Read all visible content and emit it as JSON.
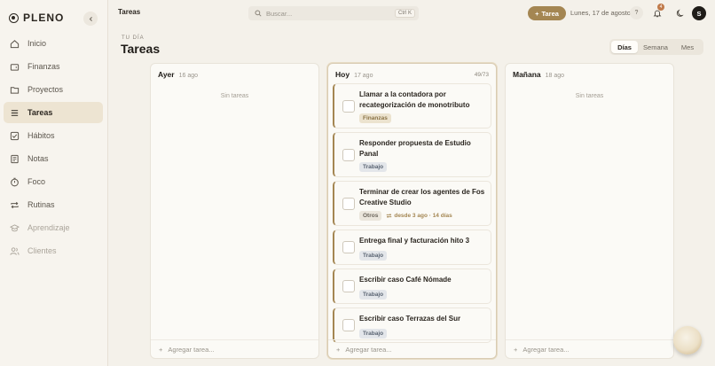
{
  "app": {
    "name": "PLENO"
  },
  "sidebar": {
    "items": [
      {
        "label": "Inicio",
        "icon": "home-icon"
      },
      {
        "label": "Finanzas",
        "icon": "wallet-icon"
      },
      {
        "label": "Proyectos",
        "icon": "folder-icon"
      },
      {
        "label": "Tareas",
        "icon": "list-icon",
        "active": true
      },
      {
        "label": "Hábitos",
        "icon": "check-square-icon"
      },
      {
        "label": "Notas",
        "icon": "note-icon"
      },
      {
        "label": "Foco",
        "icon": "timer-icon"
      },
      {
        "label": "Rutinas",
        "icon": "repeat-icon"
      },
      {
        "label": "Aprendizaje",
        "icon": "graduation-icon",
        "dim": true
      },
      {
        "label": "Clientes",
        "icon": "users-icon",
        "dim": true
      }
    ]
  },
  "topbar": {
    "title": "Tareas",
    "search_placeholder": "Buscar...",
    "search_shortcut": "Ctrl K",
    "new_task_label": "Tarea",
    "date": "Lunes, 17 de agosto",
    "help_label": "?",
    "notifications_count": "4",
    "avatar_initial": "S"
  },
  "header": {
    "eyebrow": "TU DÍA",
    "title": "Tareas",
    "views": [
      "Días",
      "Semana",
      "Mes"
    ],
    "active_view": "Días"
  },
  "columns": {
    "yesterday": {
      "day": "Ayer",
      "date": "16 ago",
      "empty": "Sin tareas",
      "add": "Agregar tarea..."
    },
    "today": {
      "day": "Hoy",
      "date": "17 ago",
      "count": "49/73",
      "add": "Agregar tarea..."
    },
    "tomorrow": {
      "day": "Mañana",
      "date": "18 ago",
      "empty": "Sin tareas",
      "add": "Agregar tarea..."
    }
  },
  "tasks": [
    {
      "title": "Llamar a la contadora por recategorización de monotributo",
      "tag": "Finanzas"
    },
    {
      "title": "Responder propuesta de Estudio Panal",
      "tag": "Trabajo"
    },
    {
      "title": "Terminar de crear los agentes de Fos Creative Studio",
      "tag": "Otros",
      "streak": "desde 3 ago · 14 días"
    },
    {
      "title": "Entrega final y facturación hito 3",
      "tag": "Trabajo"
    },
    {
      "title": "Escribir caso Café Nómade",
      "tag": "Trabajo"
    },
    {
      "title": "Escribir caso Terrazas del Sur",
      "tag": "Trabajo"
    }
  ],
  "colors": {
    "accent": "#a48652",
    "active_nav": "#ede4d2",
    "background": "#f4f1ea"
  }
}
